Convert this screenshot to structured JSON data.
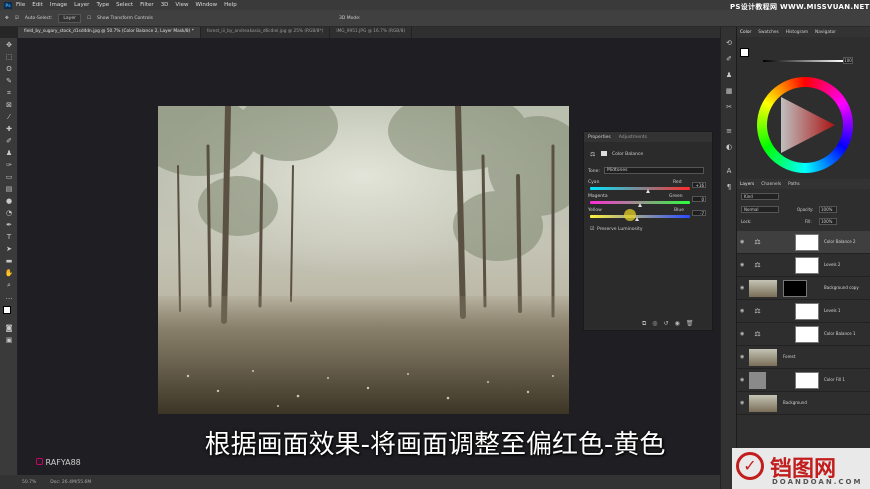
{
  "menubar": {
    "items": [
      "File",
      "Edit",
      "Image",
      "Layer",
      "Type",
      "Select",
      "Filter",
      "3D",
      "View",
      "Window",
      "Help"
    ],
    "app_icon": "Ps"
  },
  "options": {
    "auto_select": "Auto-Select:",
    "layer": "Layer",
    "transform": "Show Transform Controls",
    "mode": "3D Mode:"
  },
  "tabs": [
    {
      "label": "field_by_sugary_stock_d1sd4dn.jpg @ 50.7% (Color Balance 2, Layer Mask/8) *",
      "active": true
    },
    {
      "label": "forest_iii_by_andreakasia_d6cdiel.jpg @ 25% (RGB/8*)",
      "active": false
    },
    {
      "label": "IMG_9951.JPG @ 16.7% (RGB/8)",
      "active": false
    }
  ],
  "status": {
    "zoom": "50.7%",
    "doc": "Doc: 26.4M/55.6M"
  },
  "properties": {
    "tab1": "Properties",
    "tab2": "Adjustments",
    "title": "Color Balance",
    "tone_label": "Tone:",
    "tone_value": "Midtones",
    "cyan": "Cyan",
    "red": "Red",
    "cyan_val": "+16",
    "magenta": "Magenta",
    "green": "Green",
    "magenta_val": "0",
    "yellow": "Yellow",
    "blue": "Blue",
    "yellow_val": "-7",
    "preserve": "Preserve Luminosity",
    "sliders": {
      "cyan_red": 0.58,
      "magenta_green": 0.5,
      "yellow_blue": 0.47
    }
  },
  "color_panel": {
    "tabs": [
      "Color",
      "Swatches",
      "Histogram",
      "Navigator"
    ],
    "value": "100"
  },
  "layers_panel": {
    "tabs": [
      "Layers",
      "Channels",
      "Paths"
    ],
    "kind": "Kind",
    "blend": "Normal",
    "opacity_label": "Opacity:",
    "opacity": "100%",
    "lock_label": "Lock:",
    "fill_label": "Fill:",
    "fill": "100%",
    "layers": [
      {
        "name": "Color Balance 2",
        "type": "adjustment",
        "selected": true
      },
      {
        "name": "Levels 2",
        "type": "adjustment",
        "selected": false
      },
      {
        "name": "Background copy",
        "type": "image",
        "selected": false
      },
      {
        "name": "Levels 1",
        "type": "adjustment",
        "selected": false
      },
      {
        "name": "Color Balance 1",
        "type": "adjustment",
        "selected": false
      },
      {
        "name": "Forest",
        "type": "image",
        "selected": false
      },
      {
        "name": "Color Fill 1",
        "type": "fill",
        "selected": false
      },
      {
        "name": "Background",
        "type": "image",
        "selected": false
      }
    ]
  },
  "subtitle": "根据画面效果-将画面调整至偏红色-黄色",
  "watermark": {
    "top": "PS设计教程网 WWW.MISSVUAN.NET",
    "channel": "RAFYA88",
    "brand": "铛图网",
    "brand_url": "DOANDOAN.COM"
  },
  "colors": {
    "accent": "#31a8ff",
    "bg": "#262626",
    "panel": "#2e2e2e"
  }
}
